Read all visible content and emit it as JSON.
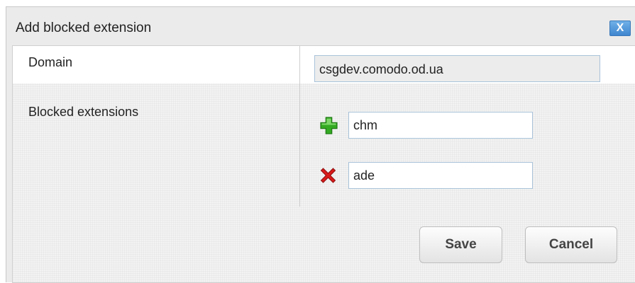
{
  "dialog": {
    "title": "Add blocked extension",
    "close_label": "X"
  },
  "form": {
    "domain_label": "Domain",
    "domain_value": "csgdev.comodo.od.ua",
    "extensions_label": "Blocked extensions",
    "extensions": [
      {
        "value": "chm",
        "action_icon": "plus-icon"
      },
      {
        "value": "ade",
        "action_icon": "remove-icon"
      }
    ]
  },
  "footer": {
    "save_label": "Save",
    "cancel_label": "Cancel"
  },
  "colors": {
    "plus_icon": "#33aa22",
    "remove_icon": "#d91a1a",
    "close_button": "#4a90d9"
  }
}
